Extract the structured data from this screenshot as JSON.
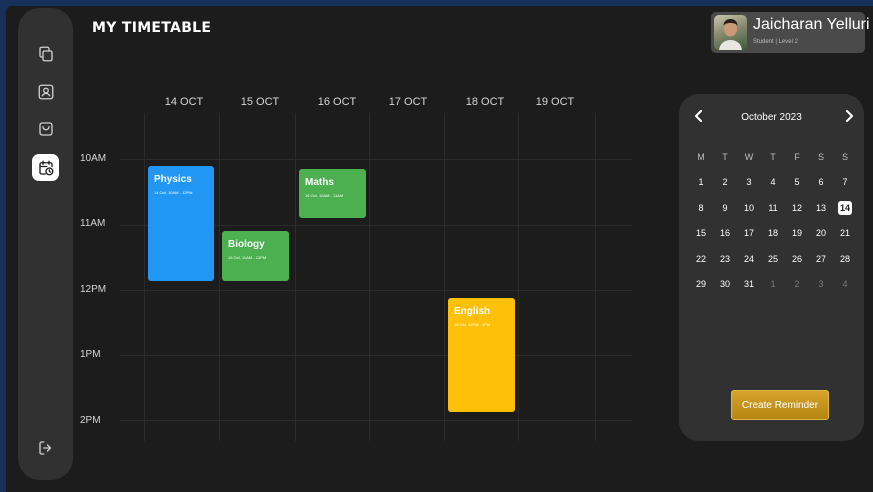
{
  "app": {
    "title": "MY TIMETABLE"
  },
  "user": {
    "name": "Jaicharan Yelluri",
    "role": "Student | Level 2"
  },
  "sidebar": {
    "items": [
      {
        "name": "copy",
        "icon": "copy-icon",
        "active": false
      },
      {
        "name": "profile",
        "icon": "profile-icon",
        "active": false
      },
      {
        "name": "bag",
        "icon": "bag-icon",
        "active": false
      },
      {
        "name": "timetable",
        "icon": "calendar-clock-icon",
        "active": true
      }
    ],
    "logout_icon": "logout-icon"
  },
  "timetable": {
    "days": [
      "14 OCT",
      "15 OCT",
      "16 OCT",
      "17 OCT",
      "18 OCT",
      "19 OCT"
    ],
    "times": [
      "10AM",
      "11AM",
      "12PM",
      "1PM",
      "2PM"
    ],
    "events": [
      {
        "title": "Physics",
        "time": "14 Oct, 10AM - 12PM",
        "color": "#2196f3"
      },
      {
        "title": "Biology",
        "time": "15 Oct, 11AM - 12PM",
        "color": "#4caf50"
      },
      {
        "title": "Maths",
        "time": "16 Oct, 10AM - 11AM",
        "color": "#4caf50"
      },
      {
        "title": "English",
        "time": "18 Oct, 12PM - 2PM",
        "color": "#ffc107"
      }
    ]
  },
  "calendar": {
    "month": "October 2023",
    "weekdays": [
      "M",
      "T",
      "W",
      "T",
      "F",
      "S",
      "S"
    ],
    "rows": [
      [
        "1",
        "2",
        "3",
        "4",
        "5",
        "6",
        "7"
      ],
      [
        "8",
        "9",
        "10",
        "11",
        "12",
        "13",
        "14"
      ],
      [
        "15",
        "16",
        "17",
        "18",
        "19",
        "20",
        "21"
      ],
      [
        "22",
        "23",
        "24",
        "25",
        "26",
        "27",
        "28"
      ],
      [
        "29",
        "30",
        "31",
        "1",
        "2",
        "3",
        "4"
      ]
    ],
    "selected": "14",
    "reminder_button": "Create Reminder"
  }
}
